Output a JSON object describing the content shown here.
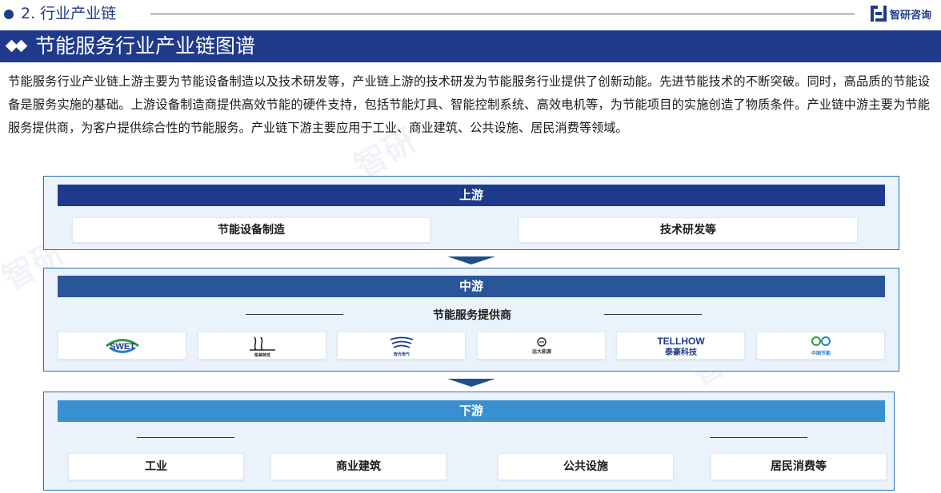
{
  "section": {
    "title": "2. 行业产业链",
    "brand_name": "智研咨询"
  },
  "title_bar": {
    "title": "节能服务行业产业链图谱"
  },
  "intro": {
    "text": "节能服务行业产业链上游主要为节能设备制造以及技术研发等，产业链上游的技术研发为节能服务行业提供了创新动能。先进节能技术的不断突破。同时，高品质的节能设备是服务实施的基础。上游设备制造商提供高效节能的硬件支持，包括节能灯具、智能控制系统、高效电机等，为节能项目的实施创造了物质条件。产业链中游主要为节能服务提供商，为客户提供综合性的节能服务。产业链下游主要应用于工业、商业建筑、公共设施、居民消费等领域。"
  },
  "upstream": {
    "label": "上游",
    "items": [
      "节能设备制造",
      "技术研发等"
    ]
  },
  "midstream": {
    "label": "中游",
    "subtitle": "节能服务提供商",
    "logos": [
      {
        "text": "SWET",
        "icon": "swet-logo"
      },
      {
        "text": "凯美特龙",
        "icon": "script-logo"
      },
      {
        "text": "智光电气",
        "icon": "waves-logo"
      },
      {
        "text": "远大能源",
        "icon": "circle-logo"
      },
      {
        "text": "TELLHOW",
        "sub": "泰豪科技",
        "icon": "tellhow-logo"
      },
      {
        "text": "中国节能",
        "icon": "cecep-logo"
      }
    ]
  },
  "downstream": {
    "label": "下游",
    "items": [
      "工业",
      "商业建筑",
      "公共设施",
      "居民消费等"
    ]
  },
  "colors": {
    "primary": "#1f3a8a",
    "midstream_head": "#2a5598",
    "downstream_head": "#3a8fd0",
    "tier_bg": "#eaf3fb"
  }
}
